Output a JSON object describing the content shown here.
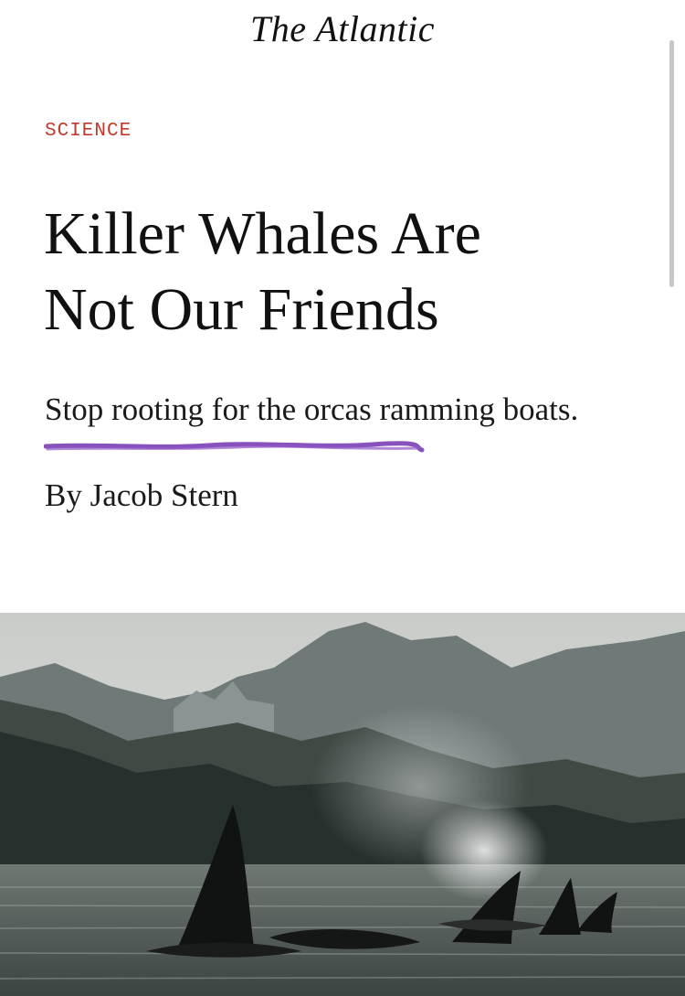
{
  "publication": {
    "masthead": "The Atlantic"
  },
  "article": {
    "section": "SCIENCE",
    "headline_line1": "Killer Whales Are",
    "headline_line2": "Not Our Friends",
    "dek": "Stop rooting for the orcas ramming boats.",
    "byline": "By Jacob Stern"
  },
  "annotation": {
    "highlight_color": "#7b3fb5"
  },
  "hero_image": {
    "description_icon": "orcas-photo"
  },
  "colors": {
    "section_label": "#c0392b",
    "text": "#111111",
    "background": "#ffffff"
  }
}
